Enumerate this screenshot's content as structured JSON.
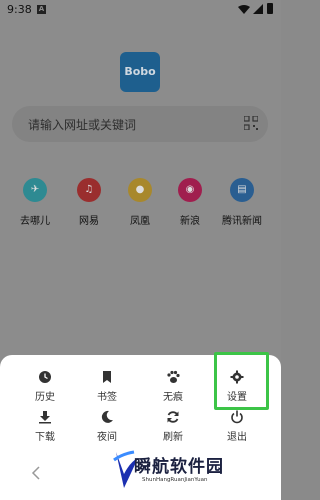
{
  "status_bar": {
    "time": "9:38",
    "notification_letter": "A"
  },
  "app": {
    "logo_text": "Bobo"
  },
  "search": {
    "placeholder": "请输入网址或关键词"
  },
  "quick_sites": [
    {
      "label": "去哪儿",
      "icon": "plane-icon",
      "color": "#2e8a92"
    },
    {
      "label": "网易",
      "icon": "music-icon",
      "color": "#9a2e2e"
    },
    {
      "label": "凤凰",
      "icon": "phoenix-icon",
      "color": "#a8882c"
    },
    {
      "label": "新浪",
      "icon": "weibo-icon",
      "color": "#a01e4e"
    },
    {
      "label": "腾讯新闻",
      "icon": "news-icon",
      "color": "#2a5e91"
    }
  ],
  "menu": {
    "row1": [
      {
        "label": "历史",
        "icon": "clock-icon"
      },
      {
        "label": "书签",
        "icon": "bookmark-icon"
      },
      {
        "label": "无痕",
        "icon": "paw-icon"
      },
      {
        "label": "设置",
        "icon": "gear-icon"
      }
    ],
    "row2": [
      {
        "label": "下载",
        "icon": "download-icon"
      },
      {
        "label": "夜间",
        "icon": "moon-icon"
      },
      {
        "label": "刷新",
        "icon": "refresh-icon"
      },
      {
        "label": "退出",
        "icon": "power-icon"
      }
    ]
  },
  "watermark": {
    "title": "瞬航软件园",
    "subtitle": "ShunHangRuanJianYuan"
  },
  "colors": {
    "highlight": "#3cc447",
    "logo_bg": "#1e5f8e"
  }
}
